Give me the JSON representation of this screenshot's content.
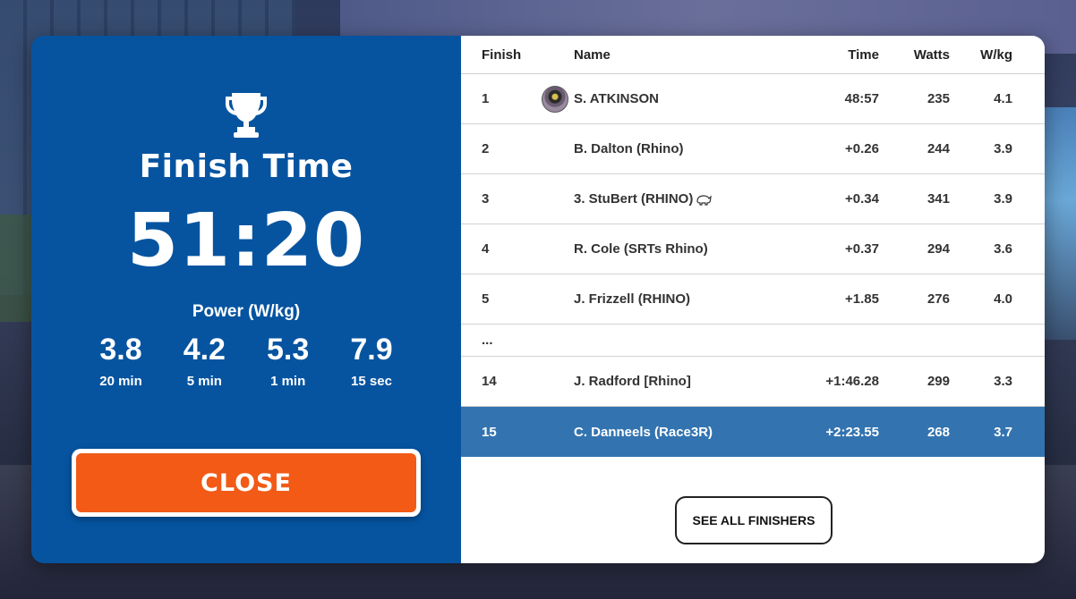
{
  "summary": {
    "title": "Finish Time",
    "time": "51:20",
    "power_label": "Power (W/kg)",
    "power": [
      {
        "value": "3.8",
        "unit": "20 min"
      },
      {
        "value": "4.2",
        "unit": "5 min"
      },
      {
        "value": "5.3",
        "unit": "1 min"
      },
      {
        "value": "7.9",
        "unit": "15 sec"
      }
    ],
    "close_label": "CLOSE"
  },
  "results": {
    "headers": {
      "finish": "Finish",
      "name": "Name",
      "time": "Time",
      "watts": "Watts",
      "wkg": "W/kg"
    },
    "rows": [
      {
        "finish": "1",
        "name": "S. ATKINSON",
        "time": "48:57",
        "watts": "235",
        "wkg": "4.1"
      },
      {
        "finish": "2",
        "name": "B. Dalton (Rhino)",
        "time": "+0.26",
        "watts": "244",
        "wkg": "3.9"
      },
      {
        "finish": "3",
        "name": "3. StuBert (RHINO)",
        "time": "+0.34",
        "watts": "341",
        "wkg": "3.9"
      },
      {
        "finish": "4",
        "name": "R. Cole (SRTs Rhino)",
        "time": "+0.37",
        "watts": "294",
        "wkg": "3.6"
      },
      {
        "finish": "5",
        "name": "J. Frizzell (RHINO)",
        "time": "+1.85",
        "watts": "276",
        "wkg": "4.0"
      },
      {
        "finish": "...",
        "name": "",
        "time": "",
        "watts": "",
        "wkg": ""
      },
      {
        "finish": "14",
        "name": "J. Radford [Rhino]",
        "time": "+1:46.28",
        "watts": "299",
        "wkg": "3.3"
      },
      {
        "finish": "15",
        "name": "C. Danneels (Race3R)",
        "time": "+2:23.55",
        "watts": "268",
        "wkg": "3.7"
      }
    ],
    "see_all_label": "SEE ALL FINISHERS"
  },
  "icons": {
    "trophy": "trophy-icon",
    "avatar": "rider-avatar",
    "rhino": "rhino-icon"
  },
  "colors": {
    "panel_blue": "#0654a0",
    "close_orange": "#f25a16",
    "highlight_row": "#3374b0"
  }
}
